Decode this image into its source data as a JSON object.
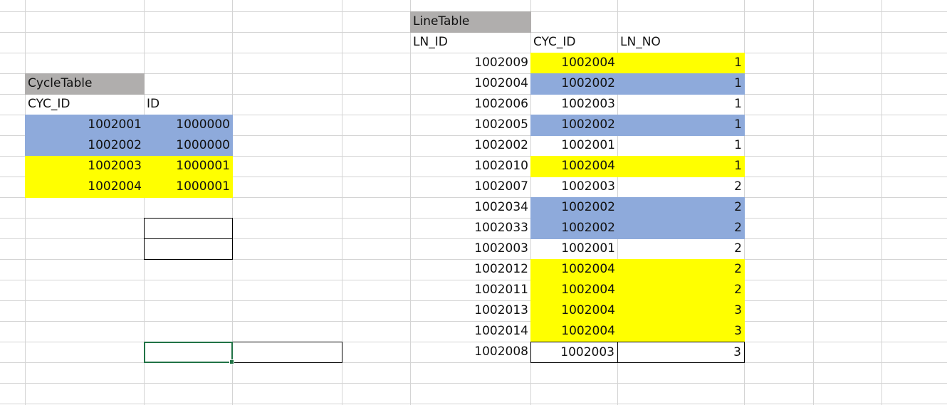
{
  "colors": {
    "header_gray": "#b0aead",
    "blue": "#8eaadb",
    "yellow": "#ffff00",
    "selection": "#217346"
  },
  "cycle_table": {
    "title": "CycleTable",
    "headers": [
      "CYC_ID",
      "ID"
    ],
    "rows": [
      {
        "cyc_id": "1002001",
        "id": "1000000",
        "color": "blue"
      },
      {
        "cyc_id": "1002002",
        "id": "1000000",
        "color": "blue"
      },
      {
        "cyc_id": "1002003",
        "id": "1000001",
        "color": "yellow"
      },
      {
        "cyc_id": "1002004",
        "id": "1000001",
        "color": "yellow"
      }
    ]
  },
  "line_table": {
    "title": "LineTable",
    "headers": [
      "LN_ID",
      "CYC_ID",
      "LN_NO"
    ],
    "rows": [
      {
        "ln_id": "1002009",
        "cyc_id": "1002004",
        "ln_no": "1",
        "color": "yellow"
      },
      {
        "ln_id": "1002004",
        "cyc_id": "1002002",
        "ln_no": "1",
        "color": "blue"
      },
      {
        "ln_id": "1002006",
        "cyc_id": "1002003",
        "ln_no": "1",
        "color": "none"
      },
      {
        "ln_id": "1002005",
        "cyc_id": "1002002",
        "ln_no": "1",
        "color": "blue"
      },
      {
        "ln_id": "1002002",
        "cyc_id": "1002001",
        "ln_no": "1",
        "color": "none"
      },
      {
        "ln_id": "1002010",
        "cyc_id": "1002004",
        "ln_no": "1",
        "color": "yellow"
      },
      {
        "ln_id": "1002007",
        "cyc_id": "1002003",
        "ln_no": "2",
        "color": "none"
      },
      {
        "ln_id": "1002034",
        "cyc_id": "1002002",
        "ln_no": "2",
        "color": "blue"
      },
      {
        "ln_id": "1002033",
        "cyc_id": "1002002",
        "ln_no": "2",
        "color": "blue"
      },
      {
        "ln_id": "1002003",
        "cyc_id": "1002001",
        "ln_no": "2",
        "color": "none"
      },
      {
        "ln_id": "1002012",
        "cyc_id": "1002004",
        "ln_no": "2",
        "color": "yellow"
      },
      {
        "ln_id": "1002011",
        "cyc_id": "1002004",
        "ln_no": "2",
        "color": "yellow"
      },
      {
        "ln_id": "1002013",
        "cyc_id": "1002004",
        "ln_no": "3",
        "color": "yellow"
      },
      {
        "ln_id": "1002014",
        "cyc_id": "1002004",
        "ln_no": "3",
        "color": "yellow"
      },
      {
        "ln_id": "1002008",
        "cyc_id": "1002003",
        "ln_no": "3",
        "color": "none"
      }
    ]
  }
}
